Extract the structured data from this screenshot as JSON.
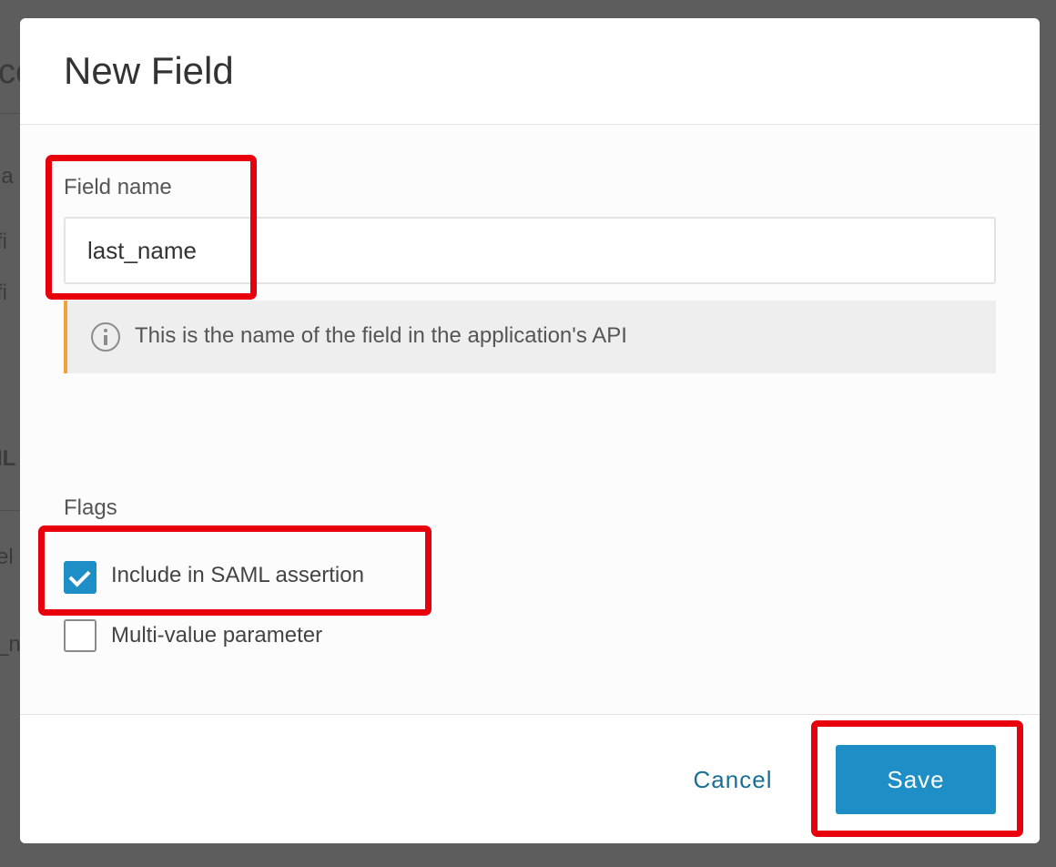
{
  "modal": {
    "title": "New Field",
    "field_label": "Field name",
    "field_value": "last_name",
    "help_text": "This is the name of the field in the application's API",
    "flags_label": "Flags",
    "flags": [
      {
        "label": "Include in SAML assertion",
        "checked": true
      },
      {
        "label": "Multi-value parameter",
        "checked": false
      }
    ],
    "cancel_label": "Cancel",
    "save_label": "Save"
  },
  "background_fragments": [
    "ce",
    "ia",
    "fi",
    "fi",
    "IL",
    "el",
    "_n"
  ],
  "colors": {
    "primary": "#1e8fc6",
    "link": "#1a6f96",
    "help_accent": "#f0a23c",
    "highlight": "#e8000d",
    "overlay": "#5c5c5c"
  },
  "icons": {
    "help": "info-icon",
    "checked": "checkmark-icon"
  }
}
